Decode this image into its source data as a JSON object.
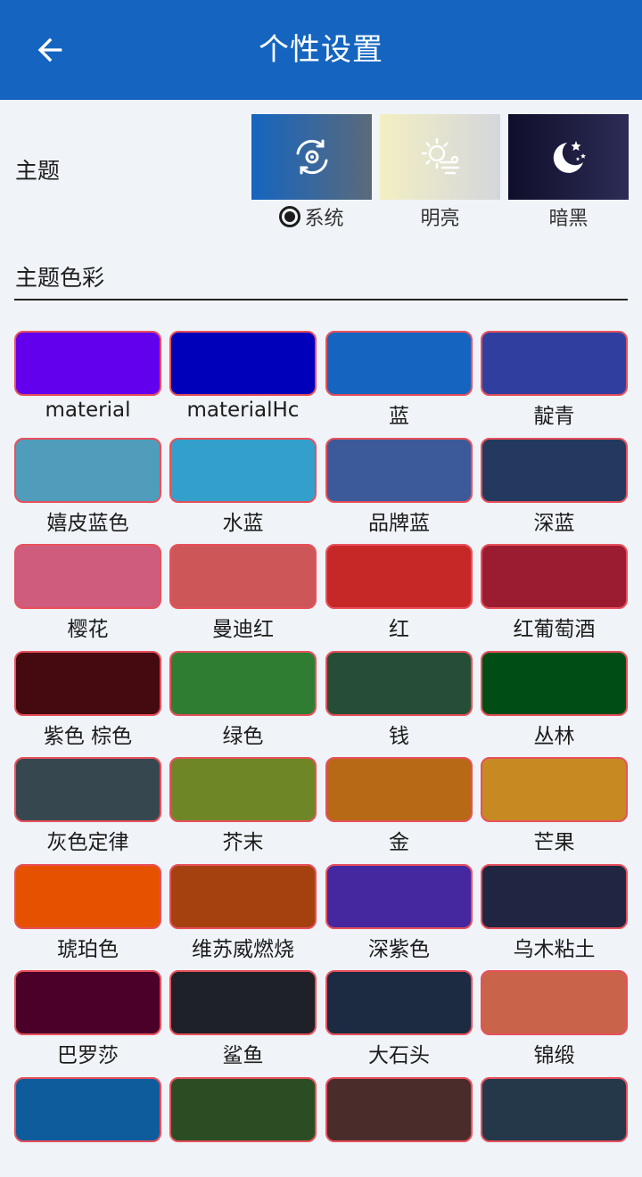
{
  "appbar": {
    "title": "个性设置",
    "back_icon": "arrow-left-icon"
  },
  "theme": {
    "label": "主题",
    "options": [
      {
        "name": "系统",
        "selected": true,
        "icon": "auto-rotate-icon"
      },
      {
        "name": "明亮",
        "selected": false,
        "icon": "sun-cloud-icon"
      },
      {
        "name": "暗黑",
        "selected": false,
        "icon": "moon-stars-icon"
      }
    ]
  },
  "colors_section": {
    "title": "主题色彩"
  },
  "swatches": [
    {
      "name": "material",
      "color": "#6200ee"
    },
    {
      "name": "materialHc",
      "color": "#0000ba"
    },
    {
      "name": "蓝",
      "color": "#1565c0"
    },
    {
      "name": "靛青",
      "color": "#303f9f"
    },
    {
      "name": "嬉皮蓝色",
      "color": "#4f9cbb"
    },
    {
      "name": "水蓝",
      "color": "#33a0cc"
    },
    {
      "name": "品牌蓝",
      "color": "#3c5a99"
    },
    {
      "name": "深蓝",
      "color": "#233a5e"
    },
    {
      "name": "樱花",
      "color": "#cf5c7d"
    },
    {
      "name": "曼迪红",
      "color": "#cd5758"
    },
    {
      "name": "红",
      "color": "#c62828"
    },
    {
      "name": "红葡萄酒",
      "color": "#9b1b30"
    },
    {
      "name": "紫色 棕色",
      "color": "#450a0f"
    },
    {
      "name": "绿色",
      "color": "#2e7d32"
    },
    {
      "name": "钱",
      "color": "#264e36"
    },
    {
      "name": "丛林",
      "color": "#004e16"
    },
    {
      "name": "灰色定律",
      "color": "#37474f"
    },
    {
      "name": "芥末",
      "color": "#6f8626"
    },
    {
      "name": "金",
      "color": "#b86915"
    },
    {
      "name": "芒果",
      "color": "#c78a23"
    },
    {
      "name": "琥珀色",
      "color": "#e65100"
    },
    {
      "name": "维苏威燃烧",
      "color": "#a5410f"
    },
    {
      "name": "深紫色",
      "color": "#4527a0"
    },
    {
      "name": "乌木粘土",
      "color": "#202541"
    },
    {
      "name": "巴罗莎",
      "color": "#4a0028"
    },
    {
      "name": "鲨鱼",
      "color": "#1e2127"
    },
    {
      "name": "大石头",
      "color": "#1c2a42"
    },
    {
      "name": "锦缎",
      "color": "#c9644a"
    },
    {
      "name": "",
      "color": "#0f5c9c"
    },
    {
      "name": "",
      "color": "#2a4d24"
    },
    {
      "name": "",
      "color": "#4a2c2a"
    },
    {
      "name": "",
      "color": "#24384a"
    }
  ]
}
